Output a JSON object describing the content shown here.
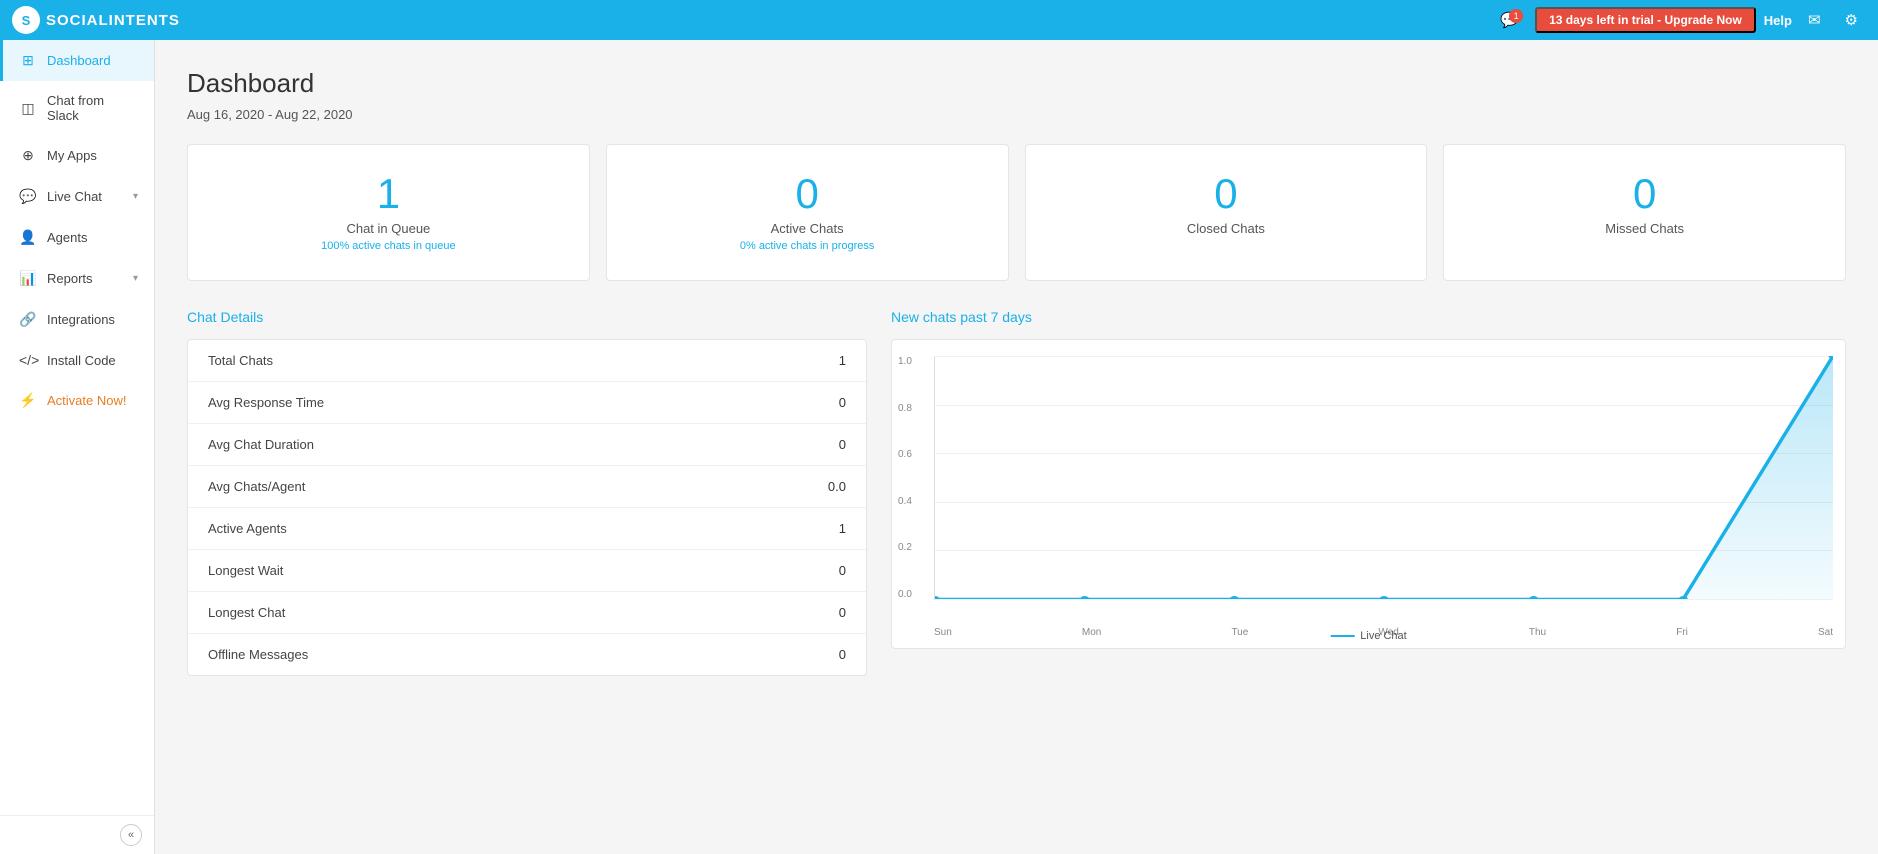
{
  "app": {
    "name": "SOCIALINTENTS",
    "logo_letter": "S"
  },
  "topbar": {
    "trial_badge": "13 days left in trial - Upgrade Now",
    "help_label": "Help",
    "notification_count": "1"
  },
  "sidebar": {
    "items": [
      {
        "id": "dashboard",
        "label": "Dashboard",
        "icon": "⊞",
        "active": true,
        "has_arrow": false
      },
      {
        "id": "chat-from-slack",
        "label": "Chat from Slack",
        "icon": "◫",
        "active": false,
        "has_arrow": false
      },
      {
        "id": "my-apps",
        "label": "My Apps",
        "icon": "⊕",
        "active": false,
        "has_arrow": false
      },
      {
        "id": "live-chat",
        "label": "Live Chat",
        "icon": "💬",
        "active": false,
        "has_arrow": true
      },
      {
        "id": "agents",
        "label": "Agents",
        "icon": "👤",
        "active": false,
        "has_arrow": false
      },
      {
        "id": "reports",
        "label": "Reports",
        "icon": "📊",
        "active": false,
        "has_arrow": true
      },
      {
        "id": "integrations",
        "label": "Integrations",
        "icon": "🔗",
        "active": false,
        "has_arrow": false
      },
      {
        "id": "install-code",
        "label": "Install Code",
        "icon": "⟨/⟩",
        "active": false,
        "has_arrow": false
      },
      {
        "id": "activate-now",
        "label": "Activate Now!",
        "icon": "⚡",
        "active": false,
        "has_arrow": false
      }
    ],
    "collapse_label": "«"
  },
  "main": {
    "page_title": "Dashboard",
    "date_range": "Aug 16, 2020 - Aug 22, 2020",
    "stat_cards": [
      {
        "id": "chat-in-queue",
        "number": "1",
        "label": "Chat in Queue",
        "sub": "100% active chats in queue"
      },
      {
        "id": "active-chats",
        "number": "0",
        "label": "Active Chats",
        "sub": "0% active chats in progress"
      },
      {
        "id": "closed-chats",
        "number": "0",
        "label": "Closed Chats",
        "sub": ""
      },
      {
        "id": "missed-chats",
        "number": "0",
        "label": "Missed Chats",
        "sub": ""
      }
    ],
    "chat_details": {
      "title": "Chat Details",
      "rows": [
        {
          "label": "Total Chats",
          "value": "1"
        },
        {
          "label": "Avg Response Time",
          "value": "0"
        },
        {
          "label": "Avg Chat Duration",
          "value": "0"
        },
        {
          "label": "Avg Chats/Agent",
          "value": "0.0"
        },
        {
          "label": "Active Agents",
          "value": "1"
        },
        {
          "label": "Longest Wait",
          "value": "0"
        },
        {
          "label": "Longest Chat",
          "value": "0"
        },
        {
          "label": "Offline Messages",
          "value": "0"
        }
      ]
    },
    "chart": {
      "title": "New chats past 7 days",
      "y_labels": [
        "1.0",
        "0.8",
        "0.6",
        "0.4",
        "0.2",
        "0.0"
      ],
      "x_labels": [
        "Sun",
        "Mon",
        "Tue",
        "Wed",
        "Thu",
        "Fri",
        "Sat"
      ],
      "legend_label": "Live Chat",
      "data_points": [
        0,
        0,
        0,
        0,
        0,
        0,
        1
      ]
    }
  }
}
